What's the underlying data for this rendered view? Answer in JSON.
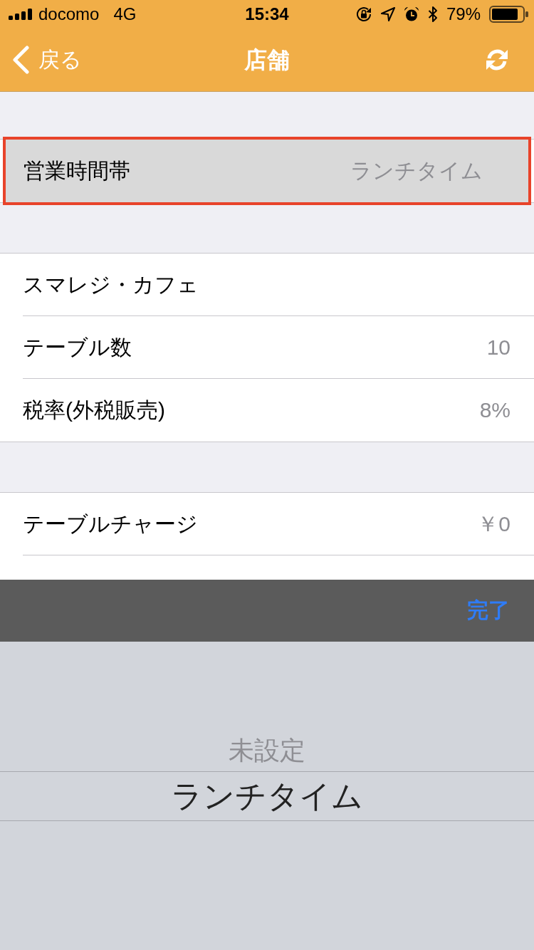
{
  "status_bar": {
    "carrier": "docomo",
    "network": "4G",
    "time": "15:34",
    "battery": "79%"
  },
  "nav_bar": {
    "back": "戻る",
    "title": "店舗"
  },
  "sections": [
    {
      "continues": false,
      "rows": [
        {
          "kind": "picker",
          "label": "営業時間帯",
          "value": "ランチタイム",
          "selected": true,
          "outlined": true
        }
      ]
    },
    {
      "continues": false,
      "rows": [
        {
          "kind": "text",
          "label": "スマレジ・カフェ",
          "selected": false,
          "outlined": false
        },
        {
          "kind": "value",
          "label": "テーブル数",
          "value": "10",
          "selected": false,
          "outlined": false
        },
        {
          "kind": "value",
          "label": "税率(外税販売)",
          "value": "8%",
          "selected": false,
          "outlined": false
        }
      ]
    },
    {
      "continues": true,
      "rows": [
        {
          "kind": "value",
          "label": "テーブルチャージ",
          "value": "￥0",
          "selected": false,
          "outlined": false
        }
      ]
    }
  ],
  "picker": {
    "done": "完了",
    "options": [
      {
        "label": "未設定",
        "selected": false
      },
      {
        "label": "ランチタイム",
        "selected": true
      }
    ]
  }
}
